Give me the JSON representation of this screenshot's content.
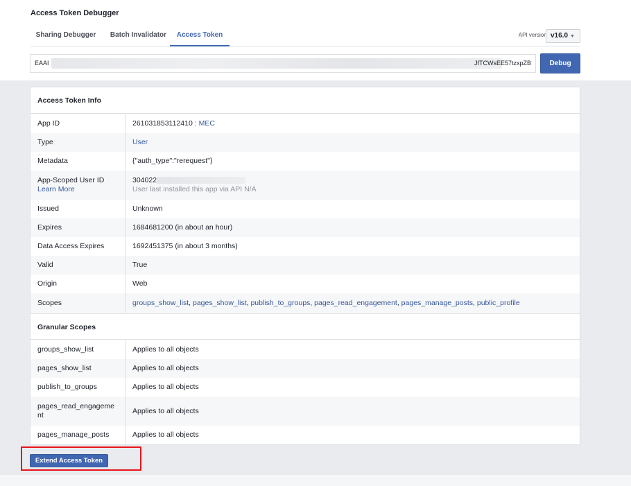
{
  "page": {
    "title": "Access Token Debugger"
  },
  "tabs": [
    {
      "label": "Sharing Debugger"
    },
    {
      "label": "Batch Invalidator"
    },
    {
      "label": "Access Token"
    }
  ],
  "api": {
    "label": "API version: [?]",
    "value": "v16.0"
  },
  "token": {
    "start": "EAAI",
    "end": "JfTCWsEE57tzxpZB"
  },
  "debug_label": "Debug",
  "info": {
    "heading": "Access Token Info",
    "app_id": {
      "key": "App ID",
      "id": "261031853112410",
      "sep": " : ",
      "name": "MEC"
    },
    "type": {
      "key": "Type",
      "value": "User"
    },
    "metadata": {
      "key": "Metadata",
      "value": "{\"auth_type\":\"rerequest\"}"
    },
    "scoped": {
      "key": "App-Scoped User ID",
      "learn": "Learn More",
      "id": "304022",
      "note": "User last installed this app via API N/A"
    },
    "issued": {
      "key": "Issued",
      "value": "Unknown"
    },
    "expires": {
      "key": "Expires",
      "value": "1684681200 (in about an hour)"
    },
    "data_expires": {
      "key": "Data Access Expires",
      "value": "1692451375 (in about 3 months)"
    },
    "valid": {
      "key": "Valid",
      "value": "True"
    },
    "origin": {
      "key": "Origin",
      "value": "Web"
    },
    "scopes": {
      "key": "Scopes",
      "items": [
        "groups_show_list",
        "pages_show_list",
        "publish_to_groups",
        "pages_read_engagement",
        "pages_manage_posts",
        "public_profile"
      ],
      "sep": ", "
    }
  },
  "granular": {
    "heading": "Granular Scopes",
    "rows": [
      {
        "scope": "groups_show_list",
        "value": "Applies to all objects"
      },
      {
        "scope": "pages_show_list",
        "value": "Applies to all objects"
      },
      {
        "scope": "publish_to_groups",
        "value": "Applies to all objects"
      },
      {
        "scope": "pages_read_engageme nt",
        "value": "Applies to all objects"
      },
      {
        "scope": "pages_manage_posts",
        "value": "Applies to all objects"
      }
    ]
  },
  "extend_label": "Extend Access Token",
  "colors": {
    "accent": "#4267b2",
    "link": "#365899",
    "highlight": "#e8141b"
  }
}
